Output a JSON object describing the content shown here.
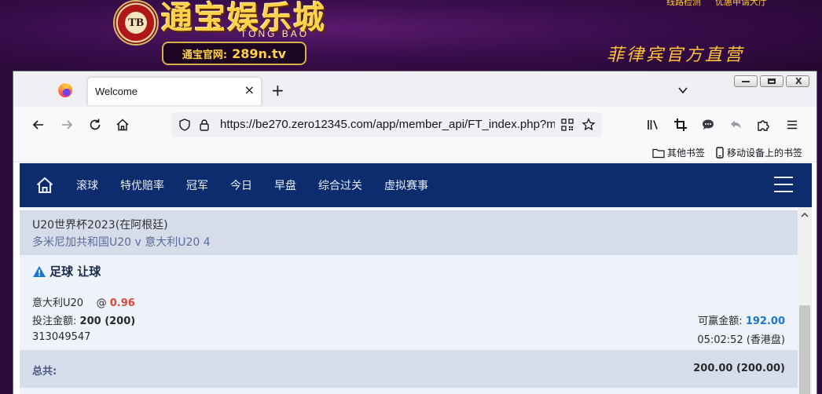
{
  "banner": {
    "logo_chip": "TB",
    "brand_cn": "通宝娱乐城",
    "brand_en": "TONG BAO",
    "site_label": "通宝官网:",
    "site_url": "289n.tv",
    "top_links": [
      "线路检测",
      "优惠申请大厅"
    ],
    "slogan": "菲律宾官方直营"
  },
  "browser": {
    "tab_title": "Welcome",
    "tab_close": "×",
    "new_tab": "+",
    "url": "https://be270.zero12345.com/app/member_api/FT_index.php?m",
    "bookmarks": [
      {
        "label": "其他书签",
        "icon": "folder-icon"
      },
      {
        "label": "移动设备上的书签",
        "icon": "mobile-icon"
      }
    ],
    "window_close": "X"
  },
  "site_nav": {
    "items": [
      "滚球",
      "特优赔率",
      "冠军",
      "今日",
      "早盘",
      "综合过关",
      "虚拟赛事"
    ]
  },
  "match": {
    "league": "U20世界杯2023(在阿根廷)",
    "teams": "多米尼加共和国U20   v   意大利U20 4"
  },
  "bet": {
    "title": "足球 让球",
    "selection": "意大利U20",
    "at": "@",
    "odds": "0.96",
    "stake_label": "投注金额:",
    "stake_value": "200 (200)",
    "win_label": "可赢金额:",
    "win_value": "192.00",
    "ticket_id": "313049547",
    "time": "05:02:52 (香港盘)"
  },
  "total": {
    "label": "总共:",
    "value": "200.00 (200.00)"
  },
  "colors": {
    "nav_bg": "#0d2c6e",
    "odds": "#e0463c",
    "win": "#1976d2"
  }
}
